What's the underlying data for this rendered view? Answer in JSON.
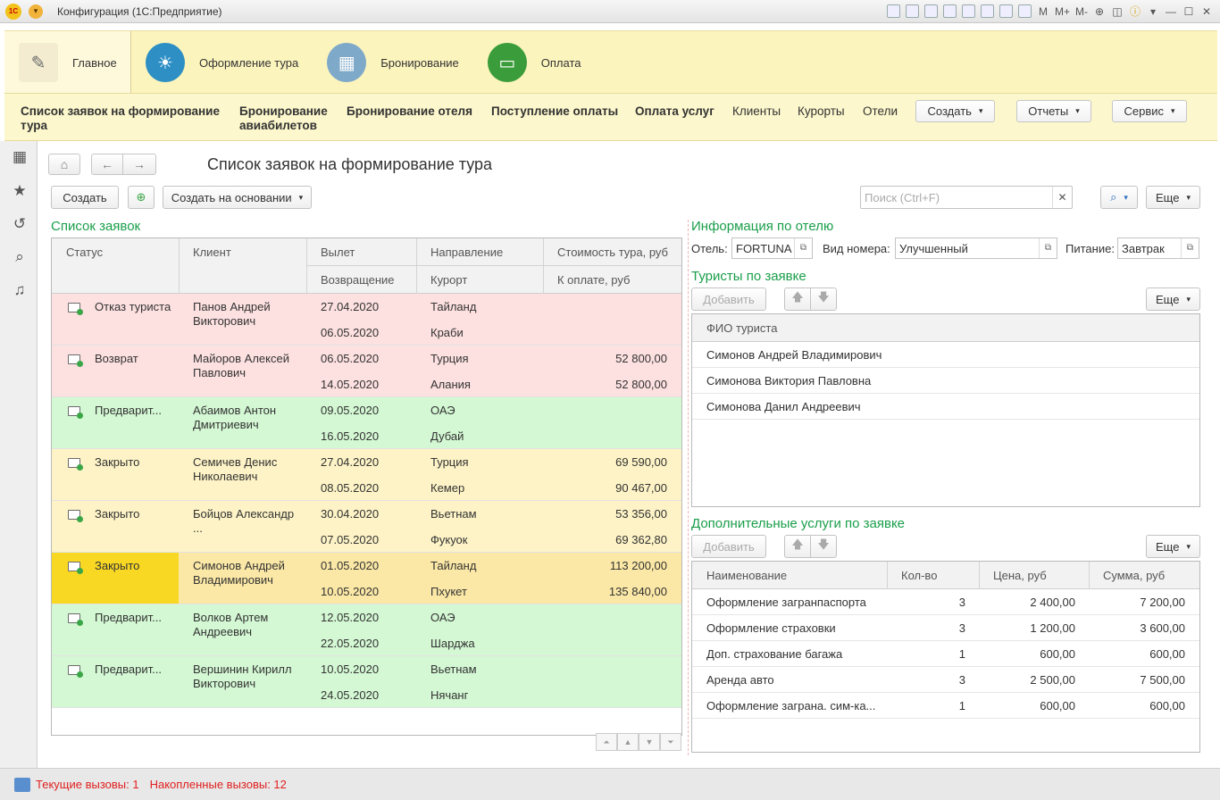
{
  "window": {
    "title": "Конфигурация (1С:Предприятие)",
    "tools": [
      "M",
      "M+",
      "M-"
    ]
  },
  "sections": [
    {
      "label": "Главное",
      "icon": "desk-lamp-icon",
      "color": "#f6f1dc"
    },
    {
      "label": "Оформление тура",
      "icon": "beach-icon",
      "color": "#2d8fc4"
    },
    {
      "label": "Бронирование",
      "icon": "calendar-clock-icon",
      "color": "#5b8fb5"
    },
    {
      "label": "Оплата",
      "icon": "wallet-icon",
      "color": "#3a9c3a"
    }
  ],
  "commands": {
    "list_orders": "Список заявок на формирование тура",
    "avia": "Бронирование авиабилетов",
    "hotel_booking": "Бронирование отеля",
    "payments_in": "Поступление оплаты",
    "pay_services": "Оплата услуг",
    "clients": "Клиенты",
    "resorts": "Курорты",
    "hotels": "Отели",
    "create": "Создать",
    "reports": "Отчеты",
    "service": "Сервис"
  },
  "page": {
    "title": "Список заявок на формирование тура",
    "create": "Создать",
    "create_based": "Создать на основании",
    "search_placeholder": "Поиск (Ctrl+F)",
    "more": "Еще"
  },
  "orders": {
    "title": "Список заявок",
    "columns": {
      "status": "Статус",
      "client": "Клиент",
      "departure": "Вылет",
      "return": "Возвращение",
      "direction": "Направление",
      "resort": "Курорт",
      "cost": "Стоимость тура, руб",
      "to_pay": "К оплате, руб"
    },
    "rows": [
      {
        "status": "Отказ туриста",
        "client": "Панов Андрей Викторович",
        "dep": "27.04.2020",
        "ret": "06.05.2020",
        "dir": "Тайланд",
        "resort": "Краби",
        "cost": "",
        "pay": "",
        "bg": "#fde0e0"
      },
      {
        "status": "Возврат",
        "client": "Майоров Алексей Павлович",
        "dep": "06.05.2020",
        "ret": "14.05.2020",
        "dir": "Турция",
        "resort": "Алания",
        "cost": "52 800,00",
        "pay": "52 800,00",
        "bg": "#fde0e0"
      },
      {
        "status": "Предварит...",
        "client": "Абаимов Антон Дмитриевич",
        "dep": "09.05.2020",
        "ret": "16.05.2020",
        "dir": "ОАЭ",
        "resort": "Дубай",
        "cost": "",
        "pay": "",
        "bg": "#d4f8d4"
      },
      {
        "status": "Закрыто",
        "client": "Семичев Денис Николаевич",
        "dep": "27.04.2020",
        "ret": "08.05.2020",
        "dir": "Турция",
        "resort": "Кемер",
        "cost": "69 590,00",
        "pay": "90 467,00",
        "bg": "#fdf3c6"
      },
      {
        "status": "Закрыто",
        "client": "Бойцов Александр ...",
        "dep": "30.04.2020",
        "ret": "07.05.2020",
        "dir": "Вьетнам",
        "resort": "Фукуок",
        "cost": "53 356,00",
        "pay": "69 362,80",
        "bg": "#fdf3c6"
      },
      {
        "status": "Закрыто",
        "client": "Симонов Андрей Владимирович",
        "dep": "01.05.2020",
        "ret": "10.05.2020",
        "dir": "Тайланд",
        "resort": "Пхукет",
        "cost": "113 200,00",
        "pay": "135 840,00",
        "bg": "#fbe8a6",
        "selected": true
      },
      {
        "status": "Предварит...",
        "client": "Волков Артем Андреевич",
        "dep": "12.05.2020",
        "ret": "22.05.2020",
        "dir": "ОАЭ",
        "resort": "Шарджа",
        "cost": "",
        "pay": "",
        "bg": "#d4f8d4"
      },
      {
        "status": "Предварит...",
        "client": "Вершинин Кирилл Викторович",
        "dep": "10.05.2020",
        "ret": "24.05.2020",
        "dir": "Вьетнам",
        "resort": "Нячанг",
        "cost": "",
        "pay": "",
        "bg": "#d4f8d4"
      }
    ]
  },
  "hotel_info": {
    "title": "Информация по отелю",
    "hotel_label": "Отель:",
    "hotel": "FORTUNA",
    "room_label": "Вид номера:",
    "room": "Улучшенный",
    "meal_label": "Питание:",
    "meal": "Завтрак"
  },
  "tourists": {
    "title": "Туристы по заявке",
    "add": "Добавить",
    "more": "Еще",
    "column": "ФИО туриста",
    "rows": [
      "Симонов Андрей Владимирович",
      "Симонова Виктория Павловна",
      "Симонова Данил Андреевич"
    ]
  },
  "services": {
    "title": "Дополнительные услуги по заявке",
    "add": "Добавить",
    "more": "Еще",
    "columns": {
      "name": "Наименование",
      "qty": "Кол-во",
      "price": "Цена, руб",
      "sum": "Сумма, руб"
    },
    "rows": [
      {
        "name": "Оформление загранпаспорта",
        "qty": "3",
        "price": "2 400,00",
        "sum": "7 200,00"
      },
      {
        "name": "Оформление страховки",
        "qty": "3",
        "price": "1 200,00",
        "sum": "3 600,00"
      },
      {
        "name": "Доп. страхование багажа",
        "qty": "1",
        "price": "600,00",
        "sum": "600,00"
      },
      {
        "name": "Аренда авто",
        "qty": "3",
        "price": "2 500,00",
        "sum": "7 500,00"
      },
      {
        "name": "Оформление заграна. сим-ка...",
        "qty": "1",
        "price": "600,00",
        "sum": "600,00"
      }
    ]
  },
  "statusbar": {
    "current": "Текущие вызовы: 1",
    "accumulated": "Накопленные вызовы: 12"
  }
}
